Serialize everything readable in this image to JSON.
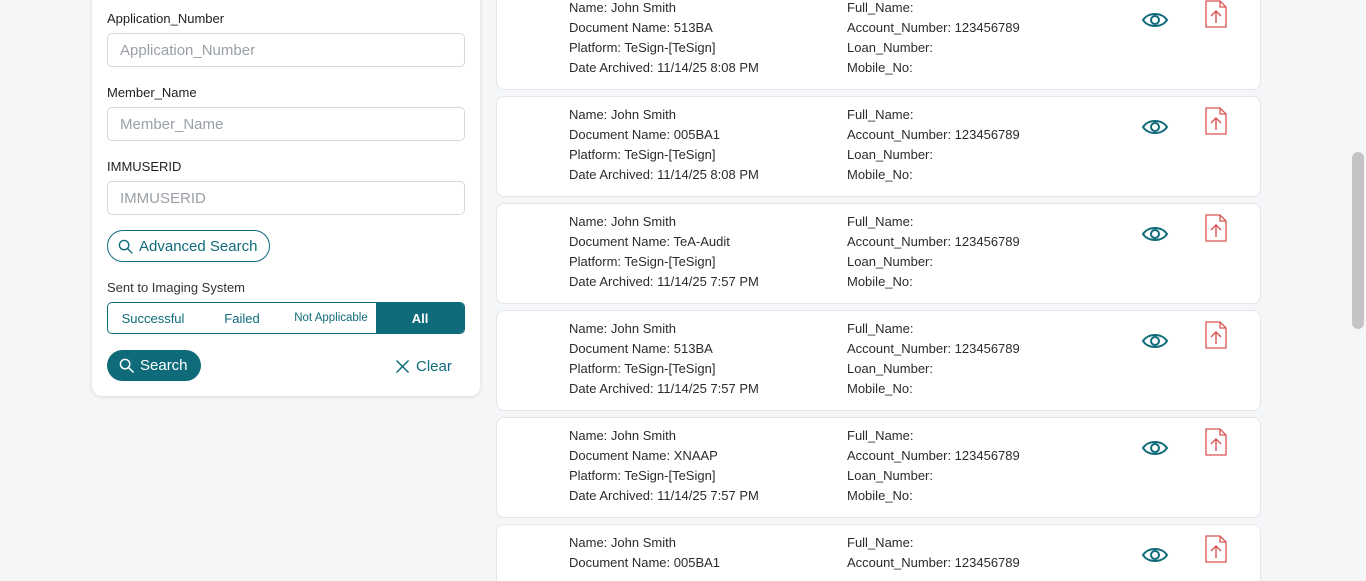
{
  "filters": {
    "application_number": {
      "label": "Application_Number",
      "placeholder": "Application_Number",
      "value": ""
    },
    "member_name": {
      "label": "Member_Name",
      "placeholder": "Member_Name",
      "value": ""
    },
    "immuserid": {
      "label": "IMMUSERID",
      "placeholder": "IMMUSERID",
      "value": ""
    },
    "advanced_search_label": "Advanced Search",
    "imaging_label": "Sent to Imaging System",
    "imaging_options": [
      "Successful",
      "Failed",
      "Not Applicable",
      "All"
    ],
    "imaging_selected": "All",
    "search_label": "Search",
    "clear_label": "Clear"
  },
  "colors": {
    "accent": "#0f6b7a",
    "pdf_icon": "#d9534f"
  },
  "icons": {
    "view": "eye-icon",
    "pdf": "pdf-file-icon",
    "search": "search-icon",
    "clear": "close-icon"
  },
  "results": [
    {
      "name": "Name: John Smith",
      "document": "Document Name: 513BA",
      "platform": "Platform: TeSign-[TeSign]",
      "archived": "Date Archived: 11/14/25 8:08 PM",
      "full_name": "Full_Name:",
      "account": "Account_Number: 123456789",
      "loan": "Loan_Number:",
      "mobile": "Mobile_No:"
    },
    {
      "name": "Name: John Smith",
      "document": "Document Name: 005BA1",
      "platform": "Platform: TeSign-[TeSign]",
      "archived": "Date Archived: 11/14/25 8:08 PM",
      "full_name": "Full_Name:",
      "account": "Account_Number: 123456789",
      "loan": "Loan_Number:",
      "mobile": "Mobile_No:"
    },
    {
      "name": "Name: John Smith",
      "document": "Document Name: TeA-Audit",
      "platform": "Platform: TeSign-[TeSign]",
      "archived": "Date Archived: 11/14/25 7:57 PM",
      "full_name": "Full_Name:",
      "account": "Account_Number: 123456789",
      "loan": "Loan_Number:",
      "mobile": "Mobile_No:"
    },
    {
      "name": "Name: John Smith",
      "document": "Document Name: 513BA",
      "platform": "Platform: TeSign-[TeSign]",
      "archived": "Date Archived: 11/14/25 7:57 PM",
      "full_name": "Full_Name:",
      "account": "Account_Number: 123456789",
      "loan": "Loan_Number:",
      "mobile": "Mobile_No:"
    },
    {
      "name": "Name: John Smith",
      "document": "Document Name: XNAAP",
      "platform": "Platform: TeSign-[TeSign]",
      "archived": "Date Archived: 11/14/25 7:57 PM",
      "full_name": "Full_Name:",
      "account": "Account_Number: 123456789",
      "loan": "Loan_Number:",
      "mobile": "Mobile_No:"
    },
    {
      "name": "Name: John Smith",
      "document": "Document Name: 005BA1",
      "platform": "",
      "archived": "",
      "full_name": "Full_Name:",
      "account": "Account_Number: 123456789",
      "loan": "",
      "mobile": ""
    }
  ]
}
